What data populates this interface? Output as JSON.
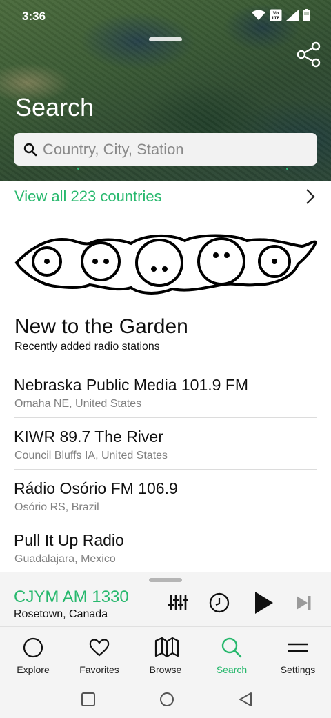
{
  "status_bar": {
    "time": "3:36"
  },
  "header": {
    "title": "Search"
  },
  "search": {
    "placeholder": "Country, City, Station",
    "value": ""
  },
  "view_all": {
    "label": "View all 223 countries"
  },
  "section": {
    "title": "New to the Garden",
    "subtitle": "Recently added radio stations"
  },
  "stations": [
    {
      "name": "Nebraska Public Media 101.9 FM",
      "location": "Omaha NE, United States"
    },
    {
      "name": "KIWR 89.7 The River",
      "location": "Council Bluffs IA, United States"
    },
    {
      "name": "Rádio Osório FM 106.9",
      "location": "Osório RS, Brazil"
    },
    {
      "name": "Pull It Up Radio",
      "location": "Guadalajara, Mexico"
    }
  ],
  "player": {
    "station": "CJYM AM 1330",
    "location": "Rosetown, Canada"
  },
  "nav": [
    {
      "label": "Explore",
      "icon": "circle-icon"
    },
    {
      "label": "Favorites",
      "icon": "heart-icon"
    },
    {
      "label": "Browse",
      "icon": "map-icon"
    },
    {
      "label": "Search",
      "icon": "search-icon",
      "active": true
    },
    {
      "label": "Settings",
      "icon": "menu-icon"
    }
  ],
  "colors": {
    "accent": "#27b86d",
    "text": "#111111",
    "muted": "#808080",
    "bar_bg": "#f4f4f4"
  }
}
